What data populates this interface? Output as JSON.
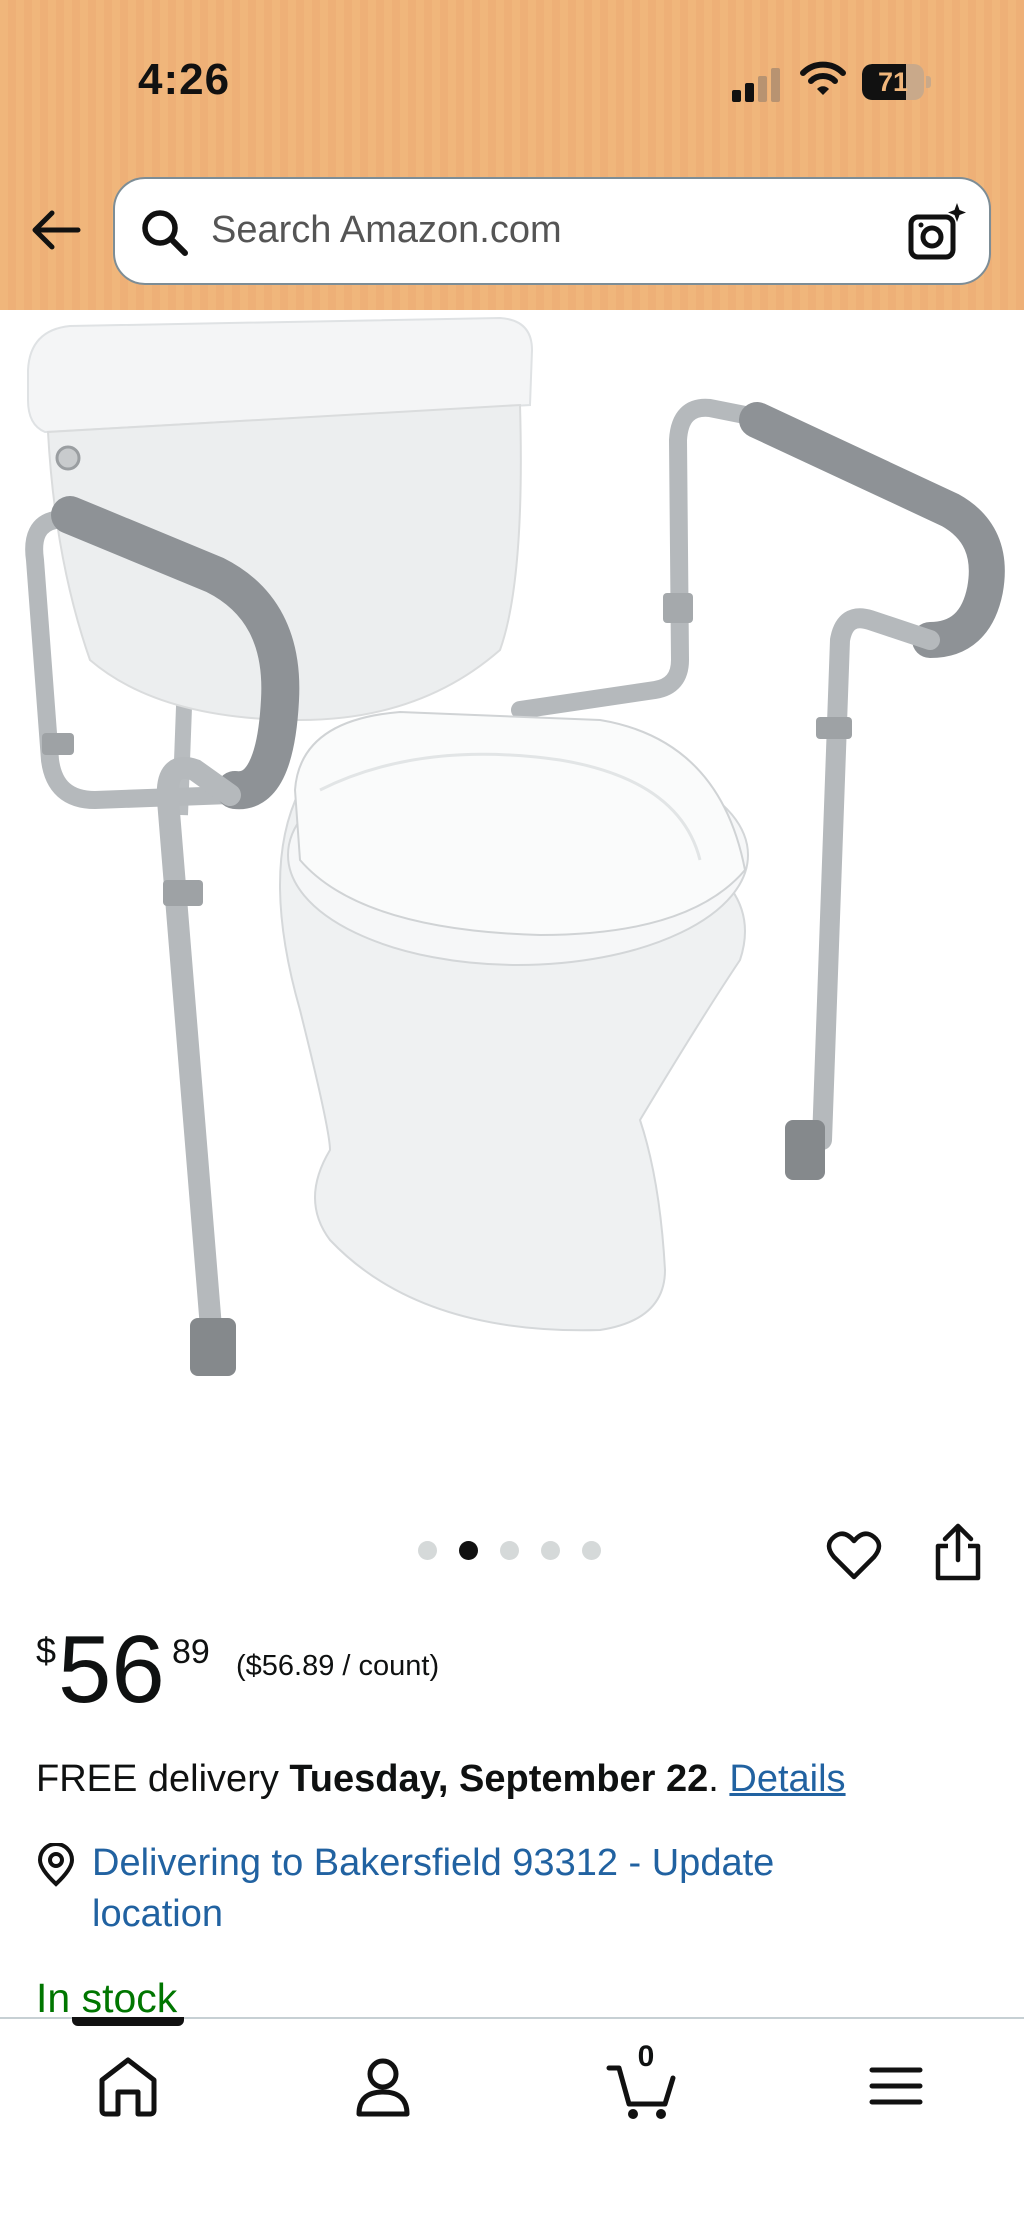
{
  "status_bar": {
    "time": "4:26",
    "battery": "71"
  },
  "search": {
    "placeholder": "Search Amazon.com"
  },
  "gallery": {
    "total_images": 5,
    "active_index": 1
  },
  "price": {
    "currency": "$",
    "whole": "56",
    "fraction": "89",
    "unit_price": "($56.89 / count)"
  },
  "delivery": {
    "prefix": "FREE delivery ",
    "date": "Tuesday, September 22",
    "suffix": ". ",
    "details_link": "Details"
  },
  "location": {
    "text": "Delivering to Bakersfield 93312 - Update location"
  },
  "availability": {
    "text": "In stock",
    "color": "#007600"
  },
  "bottom_nav": {
    "items": [
      "home-icon",
      "account-icon",
      "cart-icon",
      "menu-icon"
    ],
    "cart_count": "0"
  },
  "colors": {
    "header": "#f0b67b",
    "link": "#2162a1",
    "stock": "#007600"
  }
}
